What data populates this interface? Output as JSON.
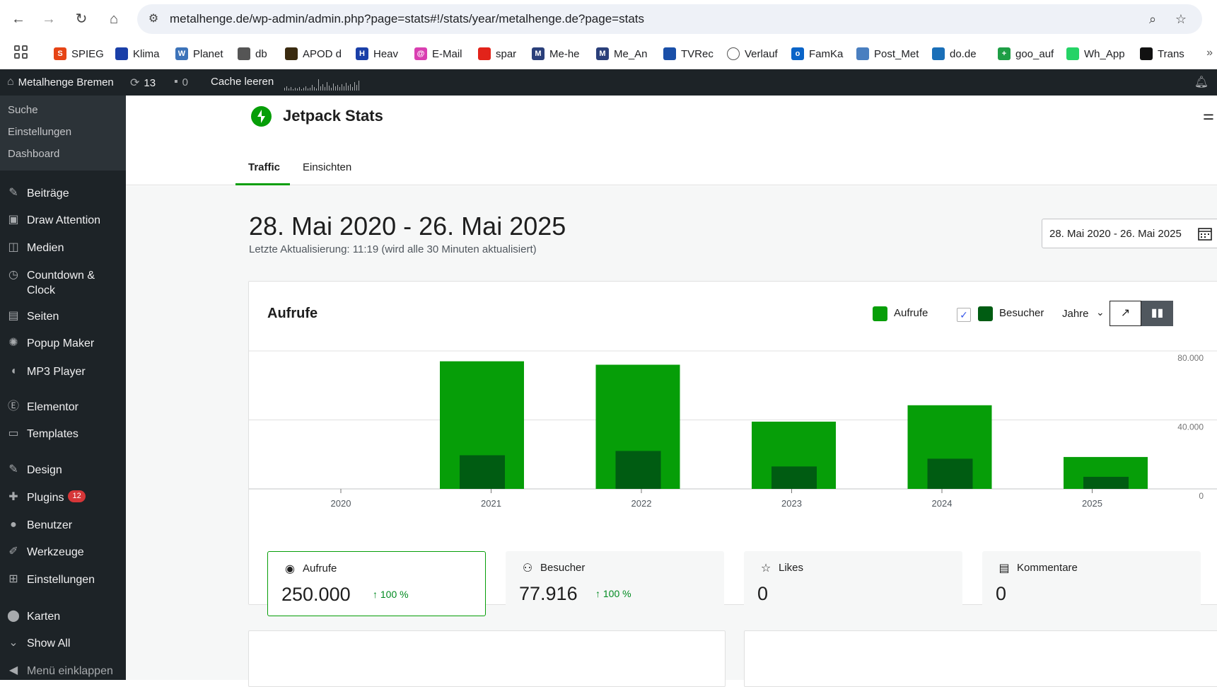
{
  "browser": {
    "url": "metalhenge.de/wp-admin/admin.php?page=stats#!/stats/year/metalhenge.de?page=stats",
    "bookmarks": [
      {
        "label": "SPIEG",
        "icon": "S",
        "color": "#e64415"
      },
      {
        "label": "Klima",
        "icon": "",
        "color": "#1a3fa8"
      },
      {
        "label": "Planet",
        "icon": "W",
        "color": "#3c73b9"
      },
      {
        "label": "db",
        "icon": "",
        "color": "#555555"
      },
      {
        "label": "APOD d",
        "icon": "",
        "color": "#3a2b10"
      },
      {
        "label": "Heav",
        "icon": "H",
        "color": "#1a3fa8"
      },
      {
        "label": "E-Mail",
        "icon": "@",
        "color": "#d93fb1"
      },
      {
        "label": "spar",
        "icon": "",
        "color": "#e2231a"
      },
      {
        "label": "Me-he",
        "icon": "M",
        "color": "#2a3f7a"
      },
      {
        "label": "Me_An",
        "icon": "M",
        "color": "#2a3f7a"
      },
      {
        "label": "TVRec",
        "icon": "",
        "color": "#1a4fa8"
      },
      {
        "label": "Verlauf",
        "icon": "",
        "color": "#ffffff"
      },
      {
        "label": "FamKa",
        "icon": "o",
        "color": "#0a64c8"
      },
      {
        "label": "Post_Met",
        "icon": "",
        "color": "#4a7fc0"
      },
      {
        "label": "do.de",
        "icon": "",
        "color": "#1a6fb8"
      },
      {
        "label": "goo_auf",
        "icon": "+",
        "color": "#1e9e45"
      },
      {
        "label": "Wh_App",
        "icon": "",
        "color": "#25d366"
      },
      {
        "label": "Trans",
        "icon": "",
        "color": "#111111"
      }
    ]
  },
  "adminbar": {
    "site_name": "Metalhenge Bremen",
    "updates_count": "13",
    "comments_count": "0",
    "cache_label": "Cache leeren"
  },
  "sidebar": {
    "submenu": [
      "Suche",
      "Einstellungen",
      "Dashboard"
    ],
    "items": [
      {
        "label": "Beiträge",
        "icon": "pin-icon"
      },
      {
        "label": "Draw Attention",
        "icon": "image-icon"
      },
      {
        "label": "Medien",
        "icon": "media-icon"
      },
      {
        "label": "Countdown & Clock",
        "icon": "clock-icon"
      },
      {
        "label": "Seiten",
        "icon": "pages-icon"
      },
      {
        "label": "Popup Maker",
        "icon": "popup-icon"
      },
      {
        "label": "MP3 Player",
        "icon": "speaker-icon"
      },
      {
        "label": "Elementor",
        "icon": "elementor-icon"
      },
      {
        "label": "Templates",
        "icon": "folder-icon"
      },
      {
        "label": "Design",
        "icon": "brush-icon"
      },
      {
        "label": "Plugins",
        "icon": "plugin-icon",
        "badge": "12"
      },
      {
        "label": "Benutzer",
        "icon": "user-icon"
      },
      {
        "label": "Werkzeuge",
        "icon": "wrench-icon"
      },
      {
        "label": "Einstellungen",
        "icon": "settings-icon"
      },
      {
        "label": "Karten",
        "icon": "map-pin-icon"
      },
      {
        "label": "Show All",
        "icon": "chevron-down-icon"
      },
      {
        "label": "Menü einklappen",
        "icon": "collapse-icon"
      }
    ]
  },
  "jetpack": {
    "title": "Jetpack Stats",
    "tabs": [
      "Traffic",
      "Einsichten"
    ],
    "date_range_title": "28. Mai 2020 - 26. Mai 2025",
    "last_update": "Letzte Aktualisierung: 11:19 (wird alle 30 Minuten aktualisiert)",
    "date_picker_label": "28. Mai 2020 - 26. Mai 2025"
  },
  "chart_card": {
    "title": "Aufrufe",
    "legend_views": "Aufrufe",
    "legend_visitors": "Besucher",
    "period": "Jahre",
    "colors": {
      "views": "#069e08",
      "visitors": "#005c12"
    }
  },
  "chart_data": {
    "type": "bar",
    "categories": [
      "2020",
      "2021",
      "2022",
      "2023",
      "2024",
      "2025"
    ],
    "series": [
      {
        "name": "Aufrufe",
        "values": [
          0,
          74000,
          72000,
          39000,
          48500,
          18500
        ]
      },
      {
        "name": "Besucher",
        "values": [
          0,
          19500,
          22000,
          13000,
          17500,
          7000
        ]
      }
    ],
    "y_ticks": [
      "0",
      "40.000",
      "80.000"
    ],
    "y_tick_values": [
      0,
      40000,
      80000
    ],
    "ylim": [
      0,
      80000
    ]
  },
  "stats": [
    {
      "label": "Aufrufe",
      "value": "250.000",
      "delta": "↑ 100 %",
      "icon": "eye-icon"
    },
    {
      "label": "Besucher",
      "value": "77.916",
      "delta": "↑ 100 %",
      "icon": "people-icon"
    },
    {
      "label": "Likes",
      "value": "0",
      "delta": "",
      "icon": "star-icon"
    },
    {
      "label": "Kommentare",
      "value": "0",
      "delta": "",
      "icon": "comment-icon"
    }
  ]
}
